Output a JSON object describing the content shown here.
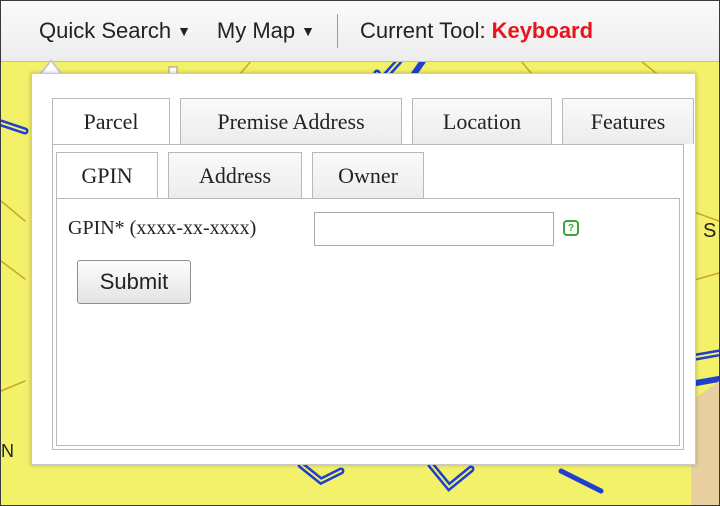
{
  "toolbar": {
    "quick_search_label": "Quick Search",
    "my_map_label": "My Map",
    "current_tool_label": "Current Tool:",
    "current_tool_value": "Keyboard",
    "current_tool_color": "#e8141e"
  },
  "map": {
    "background_color": "#f3f06a",
    "road_color": "#1e3fd0",
    "edge_labels": [
      "S",
      "N"
    ]
  },
  "search_panel": {
    "category_tabs": [
      {
        "label": "Parcel",
        "active": true
      },
      {
        "label": "Premise Address",
        "active": false
      },
      {
        "label": "Location",
        "active": false
      },
      {
        "label": "Features",
        "active": false
      }
    ],
    "parcel_tabs": [
      {
        "label": "GPIN",
        "active": true
      },
      {
        "label": "Address",
        "active": false
      },
      {
        "label": "Owner",
        "active": false
      }
    ],
    "gpin_field": {
      "label": "GPIN* (xxxx-xx-xxxx)",
      "value": "",
      "help_icon": "help-bubble-icon",
      "help_glyph": "?"
    },
    "submit_label": "Submit"
  }
}
